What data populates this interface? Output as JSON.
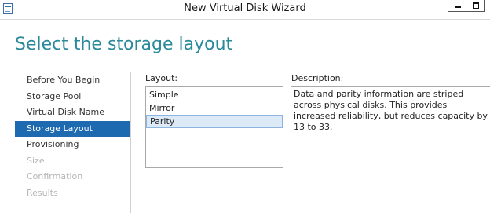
{
  "window": {
    "title": "New Virtual Disk Wizard",
    "icon": "wizard-app-icon"
  },
  "page": {
    "heading": "Select the storage layout"
  },
  "nav": {
    "items": [
      {
        "label": "Before You Begin",
        "state": "normal"
      },
      {
        "label": "Storage Pool",
        "state": "normal"
      },
      {
        "label": "Virtual Disk Name",
        "state": "normal"
      },
      {
        "label": "Storage Layout",
        "state": "active"
      },
      {
        "label": "Provisioning",
        "state": "normal"
      },
      {
        "label": "Size",
        "state": "disabled"
      },
      {
        "label": "Confirmation",
        "state": "disabled"
      },
      {
        "label": "Results",
        "state": "disabled"
      }
    ]
  },
  "layout": {
    "label": "Layout:",
    "options": [
      "Simple",
      "Mirror",
      "Parity"
    ],
    "selected": "Parity"
  },
  "description": {
    "label": "Description:",
    "text": "Data and parity information are striped across physical disks. This provides increased reliability, but reduces capacity by 13 to 33."
  },
  "colors": {
    "accent_title": "#2a8a9a",
    "nav_active_bg": "#1e6ab0",
    "selection_bg": "#dce9f7"
  }
}
